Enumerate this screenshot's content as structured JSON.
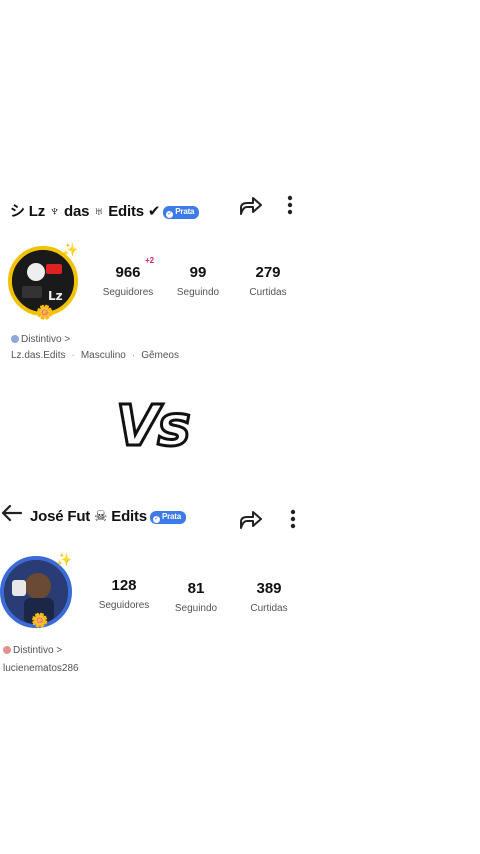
{
  "profile1": {
    "name": "シ Lz ♆ das ♅ Edits ✔",
    "tier": "Prata",
    "followers": "966",
    "followers_delta": "+2",
    "followers_label": "Seguidores",
    "following": "99",
    "following_label": "Seguindo",
    "likes": "279",
    "likes_label": "Curtidas",
    "badge_link": "Distintivo >",
    "handle": "Lz.das.Edits",
    "gender": "Masculino",
    "sign": "Gêmeos"
  },
  "vs_text": "Vs",
  "profile2": {
    "name": "José Fut ☠ Edits",
    "tier": "Prata",
    "followers": "128",
    "followers_label": "Seguidores",
    "following": "81",
    "following_label": "Seguindo",
    "likes": "389",
    "likes_label": "Curtidas",
    "badge_link": "Distintivo >",
    "handle": "lucienematos286"
  },
  "icons": [
    "share-icon",
    "more-vertical-icon",
    "back-arrow-icon",
    "badge-shield-icon"
  ],
  "colors": {
    "tier_badge": "#3d7be8",
    "avatar1_ring": "#f2c200",
    "avatar2_ring": "#3b6bd6",
    "delta": "#e0245e"
  }
}
